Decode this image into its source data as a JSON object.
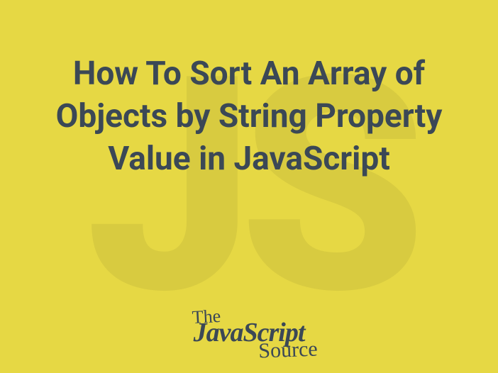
{
  "watermark": "JS",
  "title": "How To Sort An Array of Objects by String Property Value in JavaScript",
  "logo": {
    "the": "The",
    "main": "JavaScript",
    "source": "Source"
  }
}
